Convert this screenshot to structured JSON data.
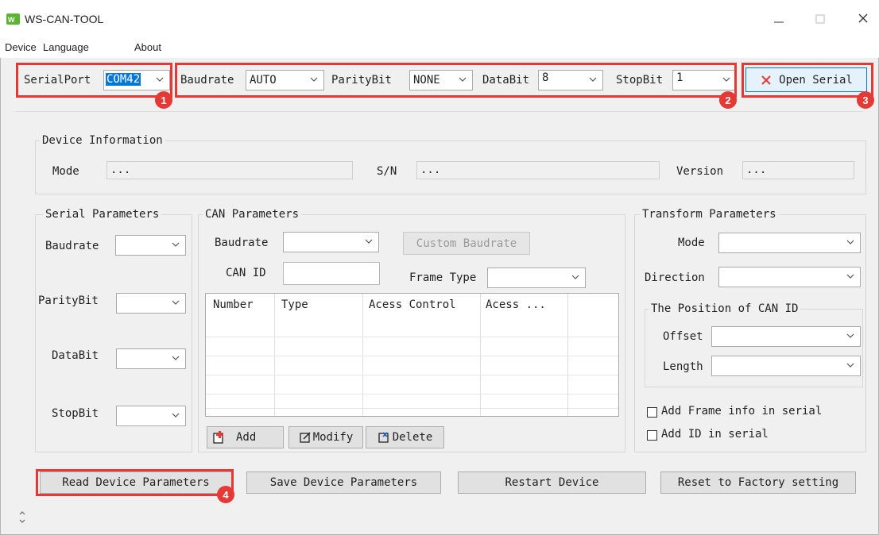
{
  "window": {
    "title": "WS-CAN-TOOL"
  },
  "menu": [
    "Device",
    "Language",
    "About"
  ],
  "toolbar": {
    "serialport_label": "SerialPort",
    "serialport_value": "COM42",
    "baudrate_label": "Baudrate",
    "baudrate_value": "AUTO",
    "parity_label": "ParityBit",
    "parity_value": "NONE",
    "databit_label": "DataBit",
    "databit_value": "8",
    "stopbit_label": "StopBit",
    "stopbit_value": "1",
    "open_serial_label": "Open Serial"
  },
  "badges": [
    "1",
    "2",
    "3",
    "4"
  ],
  "device_info": {
    "legend": "Device Information",
    "mode_label": "Mode",
    "mode_value": "...",
    "sn_label": "S/N",
    "sn_value": "...",
    "version_label": "Version",
    "version_value": "..."
  },
  "serial_params": {
    "legend": "Serial Parameters",
    "baudrate_label": "Baudrate",
    "parity_label": "ParityBit",
    "databit_label": "DataBit",
    "stopbit_label": "StopBit"
  },
  "can_params": {
    "legend": "CAN Parameters",
    "baudrate_label": "Baudrate",
    "custom_baudrate_label": "Custom Baudrate",
    "can_id_label": "CAN ID",
    "frame_type_label": "Frame Type",
    "table_columns": [
      "Number",
      "Type",
      "Acess Control",
      "Acess ..."
    ],
    "add_label": "Add",
    "modify_label": "Modify",
    "delete_label": "Delete"
  },
  "transform_params": {
    "legend": "Transform Parameters",
    "mode_label": "Mode",
    "direction_label": "Direction",
    "position_legend": "The Position of CAN ID",
    "offset_label": "Offset",
    "length_label": "Length",
    "add_frame_info_label": "Add Frame info in serial",
    "add_id_label": "Add ID in serial"
  },
  "actions": {
    "read_label": "Read Device Parameters",
    "save_label": "Save Device Parameters",
    "restart_label": "Restart Device",
    "reset_label": "Reset to Factory setting"
  },
  "icons": [
    "app-logo-icon",
    "minimize-icon",
    "maximize-icon",
    "close-icon",
    "close-x-icon",
    "chevron-down-icon",
    "add-icon",
    "modify-icon",
    "delete-icon",
    "scroll-updown-icon"
  ],
  "colors": {
    "highlight": "#e53935",
    "selection": "#0078d7"
  }
}
